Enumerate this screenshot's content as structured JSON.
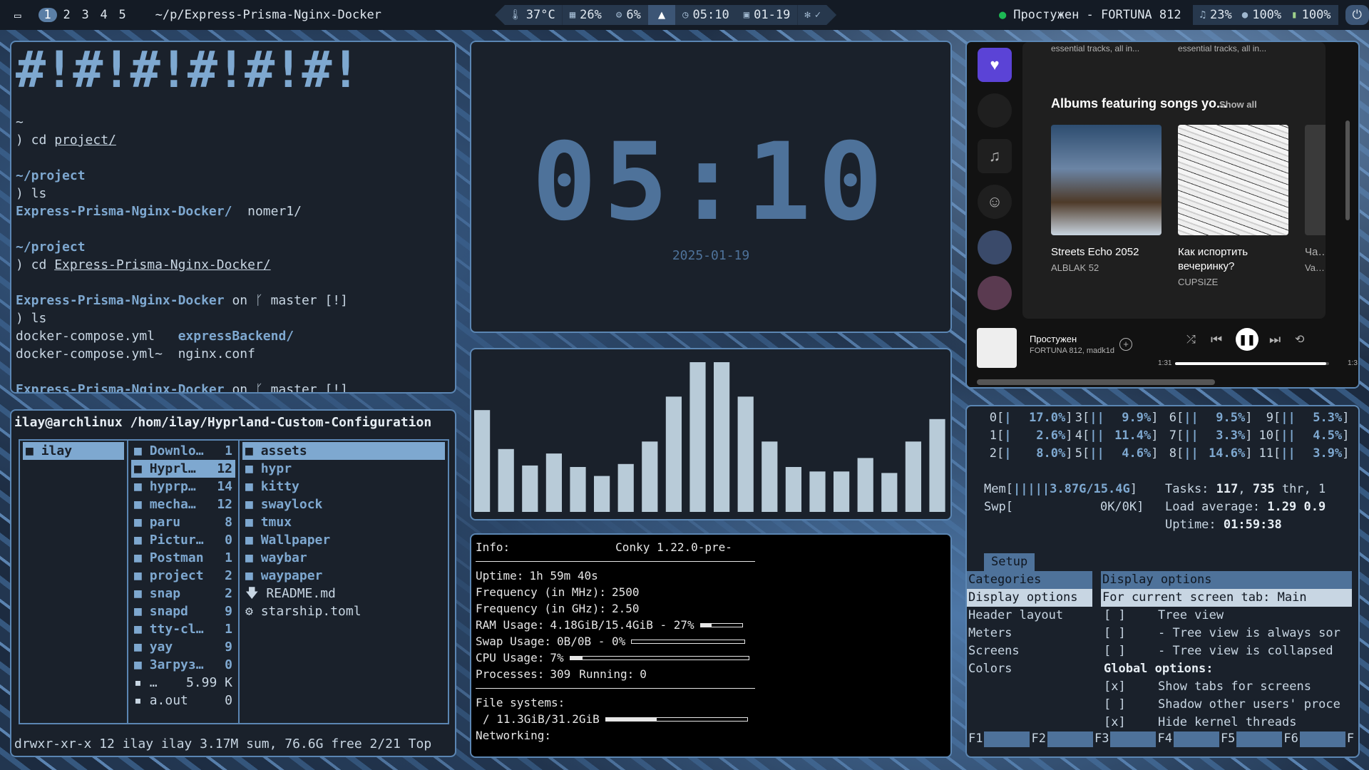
{
  "topbar": {
    "workspaces": [
      "1",
      "2",
      "3",
      "4",
      "5"
    ],
    "active_workspace": "1",
    "window_title": "~/p/Express-Prisma-Nginx-Docker",
    "temp": "37°C",
    "memory": "26%",
    "cpu": "6%",
    "time": "05:10",
    "date": "01-19",
    "now_playing": "Простужен - FORTUNA 812",
    "volume": "23%",
    "brightness": "100%",
    "battery": "100%"
  },
  "terminal": {
    "art": "#!#!#!#!#!#!",
    "lines": [
      {
        "t": "~",
        "c": "dim"
      },
      {
        "t": ") cd ",
        "c": "dim",
        "u": "project/"
      },
      {
        "t": "",
        "c": "dim"
      },
      {
        "t": "~/project",
        "c": "blue"
      },
      {
        "t": ") ls",
        "c": "dim"
      },
      {
        "t": "Express-Prisma-Nginx-Docker/",
        "c": "blue",
        "after": "  nomer1/"
      },
      {
        "t": "",
        "c": "dim"
      },
      {
        "t": "~/project",
        "c": "blue"
      },
      {
        "t": ") cd ",
        "c": "dim",
        "u": "Express-Prisma-Nginx-Docker/"
      },
      {
        "t": "",
        "c": "dim"
      },
      {
        "t": "Express-Prisma-Nginx-Docker",
        "c": "blue",
        "after": " on ᚴ master [!]"
      },
      {
        "t": ") ls",
        "c": "dim"
      },
      {
        "t": "docker-compose.yml   ",
        "c": "dim",
        "blue_after": "expressBackend/"
      },
      {
        "t": "docker-compose.yml~  nginx.conf",
        "c": "dim"
      },
      {
        "t": "",
        "c": "dim"
      },
      {
        "t": "Express-Prisma-Nginx-Docker",
        "c": "blue",
        "after": " on ᚴ master [!]"
      }
    ]
  },
  "file_manager": {
    "path": "ilay@archlinux /hom/ilay/Hyprland-Custom-Configuration",
    "col1": [
      {
        "name": "ilay",
        "sel": true
      }
    ],
    "col2": [
      {
        "name": "Downlo…",
        "n": "1"
      },
      {
        "name": "Hyprl…",
        "n": "12",
        "sel": true
      },
      {
        "name": "hyprp…",
        "n": "14"
      },
      {
        "name": "mecha…",
        "n": "12"
      },
      {
        "name": "paru",
        "n": "8"
      },
      {
        "name": "Pictur…",
        "n": "0"
      },
      {
        "name": "Postman",
        "n": "1"
      },
      {
        "name": "project",
        "n": "2"
      },
      {
        "name": "snap",
        "n": "2"
      },
      {
        "name": "snapd",
        "n": "9"
      },
      {
        "name": "tty-cl…",
        "n": "1"
      },
      {
        "name": "yay",
        "n": "9"
      },
      {
        "name": "Загруз…",
        "n": "0"
      },
      {
        "name": "…",
        "n": "5.99 K",
        "file": true
      },
      {
        "name": "a.out",
        "n": "0",
        "file": true
      }
    ],
    "col3": [
      {
        "name": "assets",
        "sel": true
      },
      {
        "name": "hypr"
      },
      {
        "name": "kitty"
      },
      {
        "name": "swaylock"
      },
      {
        "name": "tmux"
      },
      {
        "name": "Wallpaper"
      },
      {
        "name": "waybar"
      },
      {
        "name": "waypaper"
      },
      {
        "name": "README.md",
        "file": true,
        "icon": "🡇"
      },
      {
        "name": "starship.toml",
        "file": true,
        "icon": "⚙"
      }
    ],
    "status": "drwxr-xr-x 12 ilay ilay 3.17M sum, 76.6G free  2/21  Top"
  },
  "clock": {
    "time": "05:10",
    "date": "2025-01-19"
  },
  "visualizer": {
    "levels": [
      0.68,
      0.42,
      0.31,
      0.39,
      0.3,
      0.24,
      0.32,
      0.47,
      0.77,
      1.0,
      1.0,
      0.77,
      0.47,
      0.3,
      0.27,
      0.27,
      0.36,
      0.26,
      0.47,
      0.62
    ]
  },
  "conky": {
    "info_label": "Info:",
    "version": "Conky 1.22.0-pre-",
    "uptime_label": "Uptime:",
    "uptime": "1h 59m 40s",
    "freq_mhz_label": "Frequency (in MHz):",
    "freq_mhz": "2500",
    "freq_ghz_label": "Frequency (in GHz):",
    "freq_ghz": "2.50",
    "ram_label": "RAM Usage:",
    "ram": "4.18GiB/15.4GiB - 27%",
    "ram_pct": 0.27,
    "swap_label": "Swap Usage:",
    "swap": "0B/0B - 0%",
    "swap_pct": 0,
    "cpu_label": "CPU Usage:",
    "cpu": "7%",
    "cpu_pct": 0.07,
    "proc_label": "Processes:",
    "proc": "309",
    "running_label": "Running:",
    "running": "0",
    "fs_label": "File systems:",
    "fs_root": "/ 11.3GiB/31.2GiB",
    "fs_pct": 0.36,
    "net_label": "Networking:"
  },
  "spotify": {
    "top_text_1": "essential tracks, all in...",
    "top_text_2": "essential tracks, all in...",
    "section_title": "Albums featuring songs yo...",
    "show_all": "Show all",
    "albums": [
      {
        "name": "Streets Echo 2052",
        "artist": "ALBLAK 52"
      },
      {
        "name": "Как испортить вечеринку?",
        "artist": "CUPSIZE"
      },
      {
        "name": "Ча…",
        "artist": "Va…"
      }
    ],
    "track": "Простужен",
    "artists": "FORTUNA 812, madk1d",
    "elapsed": "1:31",
    "total": "1:3",
    "progress": 0.98
  },
  "htop": {
    "cpus": [
      {
        "id": "0",
        "bar": "|",
        "val": "17.0%"
      },
      {
        "id": "1",
        "bar": "|",
        "val": "2.6%"
      },
      {
        "id": "2",
        "bar": "|",
        "val": "8.0%"
      },
      {
        "id": "3",
        "bar": "||",
        "val": "9.9%"
      },
      {
        "id": "4",
        "bar": "||",
        "val": "11.4%"
      },
      {
        "id": "5",
        "bar": "||",
        "val": "4.6%"
      },
      {
        "id": "6",
        "bar": "||",
        "val": "9.5%"
      },
      {
        "id": "7",
        "bar": "||",
        "val": "3.3%"
      },
      {
        "id": "8",
        "bar": "||",
        "val": "14.6%"
      },
      {
        "id": "9",
        "bar": "||",
        "val": "5.3%"
      },
      {
        "id": "10",
        "bar": "||",
        "val": "4.5%"
      },
      {
        "id": "11",
        "bar": "||",
        "val": "3.9%"
      }
    ],
    "mem": "3.87G/15.4G",
    "swp": "0K/0K",
    "tasks": "117",
    "thr": "735",
    "thr_rest": "thr, 1",
    "load": "1.29 0.9",
    "uptime": "01:59:38",
    "setup": "Setup",
    "categories": [
      "Categories",
      "Display options",
      "Header layout",
      "Meters",
      "Screens",
      "Colors"
    ],
    "options_title": "Display options",
    "options_tab": "For current screen tab: Main",
    "options": [
      {
        "box": "[ ]",
        "label": "Tree view"
      },
      {
        "box": "[ ]",
        "label": "- Tree view is always sor"
      },
      {
        "box": "[ ]",
        "label": "- Tree view is collapsed"
      },
      {
        "box": "",
        "label": "Global options:",
        "bold": true
      },
      {
        "box": "[x]",
        "label": "Show tabs for screens"
      },
      {
        "box": "[ ]",
        "label": "Shadow other users' proce"
      },
      {
        "box": "[x]",
        "label": "Hide kernel threads"
      }
    ],
    "fkeys": [
      "F1",
      "F2",
      "F3",
      "F4",
      "F5",
      "F6",
      "F"
    ]
  }
}
